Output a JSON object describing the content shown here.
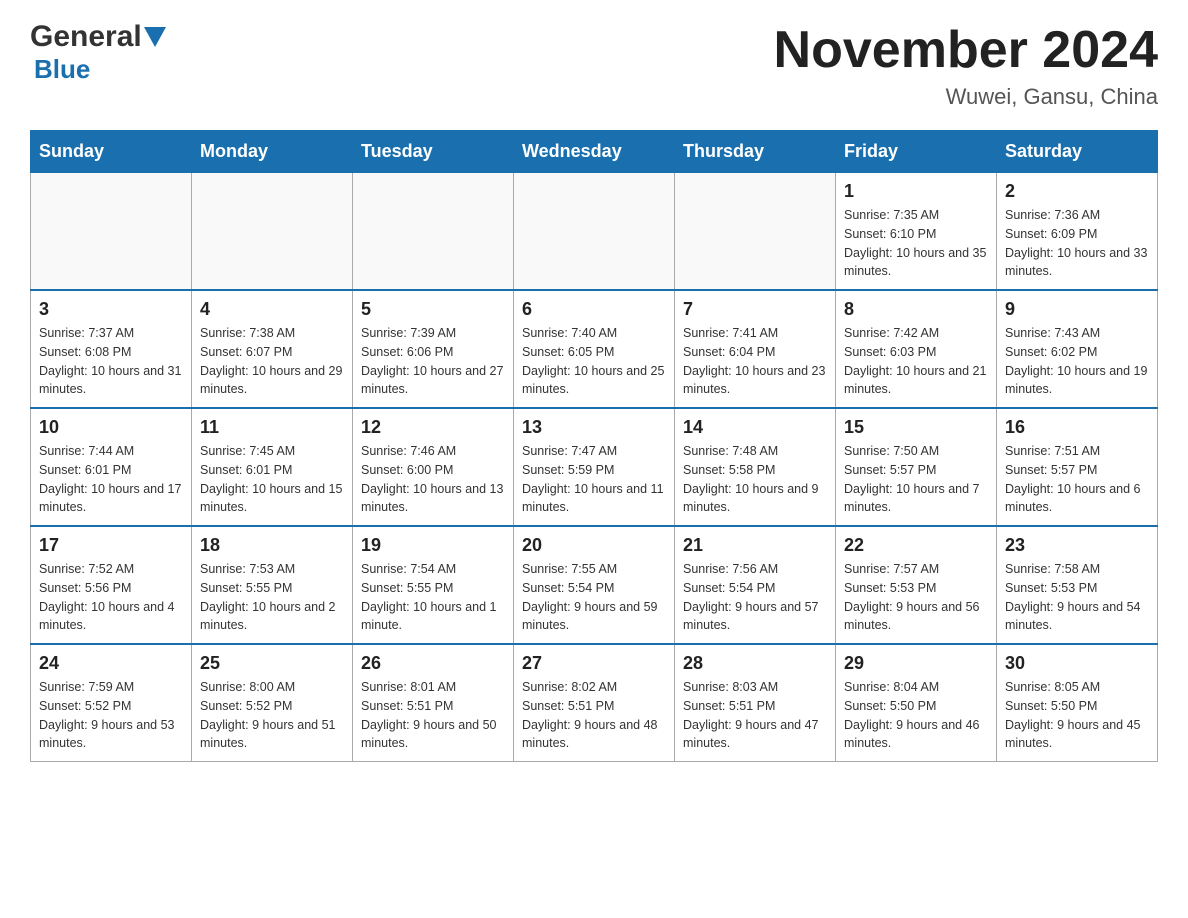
{
  "header": {
    "logo_general": "General",
    "logo_blue": "Blue",
    "main_title": "November 2024",
    "subtitle": "Wuwei, Gansu, China"
  },
  "days_of_week": [
    "Sunday",
    "Monday",
    "Tuesday",
    "Wednesday",
    "Thursday",
    "Friday",
    "Saturday"
  ],
  "weeks": [
    {
      "days": [
        {
          "number": "",
          "info": ""
        },
        {
          "number": "",
          "info": ""
        },
        {
          "number": "",
          "info": ""
        },
        {
          "number": "",
          "info": ""
        },
        {
          "number": "",
          "info": ""
        },
        {
          "number": "1",
          "info": "Sunrise: 7:35 AM\nSunset: 6:10 PM\nDaylight: 10 hours and 35 minutes."
        },
        {
          "number": "2",
          "info": "Sunrise: 7:36 AM\nSunset: 6:09 PM\nDaylight: 10 hours and 33 minutes."
        }
      ]
    },
    {
      "days": [
        {
          "number": "3",
          "info": "Sunrise: 7:37 AM\nSunset: 6:08 PM\nDaylight: 10 hours and 31 minutes."
        },
        {
          "number": "4",
          "info": "Sunrise: 7:38 AM\nSunset: 6:07 PM\nDaylight: 10 hours and 29 minutes."
        },
        {
          "number": "5",
          "info": "Sunrise: 7:39 AM\nSunset: 6:06 PM\nDaylight: 10 hours and 27 minutes."
        },
        {
          "number": "6",
          "info": "Sunrise: 7:40 AM\nSunset: 6:05 PM\nDaylight: 10 hours and 25 minutes."
        },
        {
          "number": "7",
          "info": "Sunrise: 7:41 AM\nSunset: 6:04 PM\nDaylight: 10 hours and 23 minutes."
        },
        {
          "number": "8",
          "info": "Sunrise: 7:42 AM\nSunset: 6:03 PM\nDaylight: 10 hours and 21 minutes."
        },
        {
          "number": "9",
          "info": "Sunrise: 7:43 AM\nSunset: 6:02 PM\nDaylight: 10 hours and 19 minutes."
        }
      ]
    },
    {
      "days": [
        {
          "number": "10",
          "info": "Sunrise: 7:44 AM\nSunset: 6:01 PM\nDaylight: 10 hours and 17 minutes."
        },
        {
          "number": "11",
          "info": "Sunrise: 7:45 AM\nSunset: 6:01 PM\nDaylight: 10 hours and 15 minutes."
        },
        {
          "number": "12",
          "info": "Sunrise: 7:46 AM\nSunset: 6:00 PM\nDaylight: 10 hours and 13 minutes."
        },
        {
          "number": "13",
          "info": "Sunrise: 7:47 AM\nSunset: 5:59 PM\nDaylight: 10 hours and 11 minutes."
        },
        {
          "number": "14",
          "info": "Sunrise: 7:48 AM\nSunset: 5:58 PM\nDaylight: 10 hours and 9 minutes."
        },
        {
          "number": "15",
          "info": "Sunrise: 7:50 AM\nSunset: 5:57 PM\nDaylight: 10 hours and 7 minutes."
        },
        {
          "number": "16",
          "info": "Sunrise: 7:51 AM\nSunset: 5:57 PM\nDaylight: 10 hours and 6 minutes."
        }
      ]
    },
    {
      "days": [
        {
          "number": "17",
          "info": "Sunrise: 7:52 AM\nSunset: 5:56 PM\nDaylight: 10 hours and 4 minutes."
        },
        {
          "number": "18",
          "info": "Sunrise: 7:53 AM\nSunset: 5:55 PM\nDaylight: 10 hours and 2 minutes."
        },
        {
          "number": "19",
          "info": "Sunrise: 7:54 AM\nSunset: 5:55 PM\nDaylight: 10 hours and 1 minute."
        },
        {
          "number": "20",
          "info": "Sunrise: 7:55 AM\nSunset: 5:54 PM\nDaylight: 9 hours and 59 minutes."
        },
        {
          "number": "21",
          "info": "Sunrise: 7:56 AM\nSunset: 5:54 PM\nDaylight: 9 hours and 57 minutes."
        },
        {
          "number": "22",
          "info": "Sunrise: 7:57 AM\nSunset: 5:53 PM\nDaylight: 9 hours and 56 minutes."
        },
        {
          "number": "23",
          "info": "Sunrise: 7:58 AM\nSunset: 5:53 PM\nDaylight: 9 hours and 54 minutes."
        }
      ]
    },
    {
      "days": [
        {
          "number": "24",
          "info": "Sunrise: 7:59 AM\nSunset: 5:52 PM\nDaylight: 9 hours and 53 minutes."
        },
        {
          "number": "25",
          "info": "Sunrise: 8:00 AM\nSunset: 5:52 PM\nDaylight: 9 hours and 51 minutes."
        },
        {
          "number": "26",
          "info": "Sunrise: 8:01 AM\nSunset: 5:51 PM\nDaylight: 9 hours and 50 minutes."
        },
        {
          "number": "27",
          "info": "Sunrise: 8:02 AM\nSunset: 5:51 PM\nDaylight: 9 hours and 48 minutes."
        },
        {
          "number": "28",
          "info": "Sunrise: 8:03 AM\nSunset: 5:51 PM\nDaylight: 9 hours and 47 minutes."
        },
        {
          "number": "29",
          "info": "Sunrise: 8:04 AM\nSunset: 5:50 PM\nDaylight: 9 hours and 46 minutes."
        },
        {
          "number": "30",
          "info": "Sunrise: 8:05 AM\nSunset: 5:50 PM\nDaylight: 9 hours and 45 minutes."
        }
      ]
    }
  ]
}
